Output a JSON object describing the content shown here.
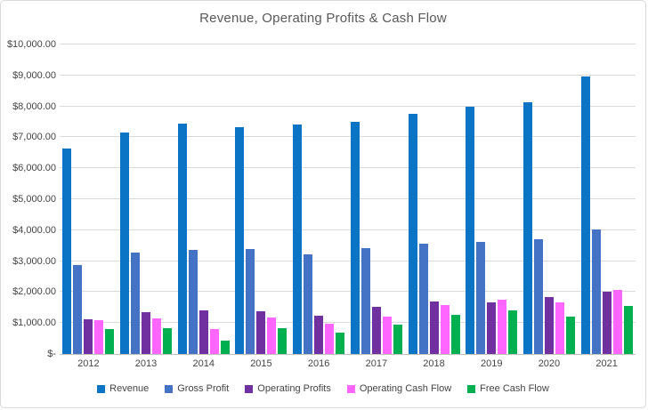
{
  "title": "Revenue, Operating Profits & Cash Flow",
  "chart_data": {
    "type": "bar",
    "title": "Revenue, Operating Profits & Cash Flow",
    "categories": [
      "2012",
      "2013",
      "2014",
      "2015",
      "2016",
      "2017",
      "2018",
      "2019",
      "2020",
      "2021"
    ],
    "series": [
      {
        "name": "Revenue",
        "color": "#0b74c4",
        "values": [
          6630,
          7150,
          7440,
          7340,
          7420,
          7510,
          7770,
          7980,
          8130,
          8970
        ]
      },
      {
        "name": "Gross Profit",
        "color": "#4472c4",
        "values": [
          2880,
          3270,
          3350,
          3390,
          3210,
          3430,
          3560,
          3630,
          3700,
          4030
        ]
      },
      {
        "name": "Operating Profits",
        "color": "#7030a0",
        "values": [
          1130,
          1340,
          1420,
          1390,
          1240,
          1520,
          1690,
          1680,
          1830,
          2020
        ]
      },
      {
        "name": "Operating Cash Flow",
        "color": "#ff66ff",
        "values": [
          1080,
          1150,
          810,
          1190,
          970,
          1220,
          1580,
          1740,
          1680,
          2080
        ]
      },
      {
        "name": "Free Cash Flow",
        "color": "#00b050",
        "values": [
          800,
          830,
          440,
          820,
          680,
          950,
          1260,
          1400,
          1220,
          1560
        ]
      }
    ],
    "xlabel": "",
    "ylabel": "",
    "y_axis": {
      "min": 0,
      "max": 10000,
      "step": 1000,
      "tick_labels": [
        "$-",
        "$1,000.00",
        "$2,000.00",
        "$3,000.00",
        "$4,000.00",
        "$5,000.00",
        "$6,000.00",
        "$7,000.00",
        "$8,000.00",
        "$9,000.00",
        "$10,000.00"
      ]
    },
    "grid": true,
    "legend_position": "bottom"
  },
  "colors": {
    "title_text": "#595959",
    "axis_text": "#444444",
    "gridline": "#d9d9d9",
    "axis_line": "#bfbfbf",
    "frame_border": "#d9d9d9",
    "background": "#ffffff"
  }
}
